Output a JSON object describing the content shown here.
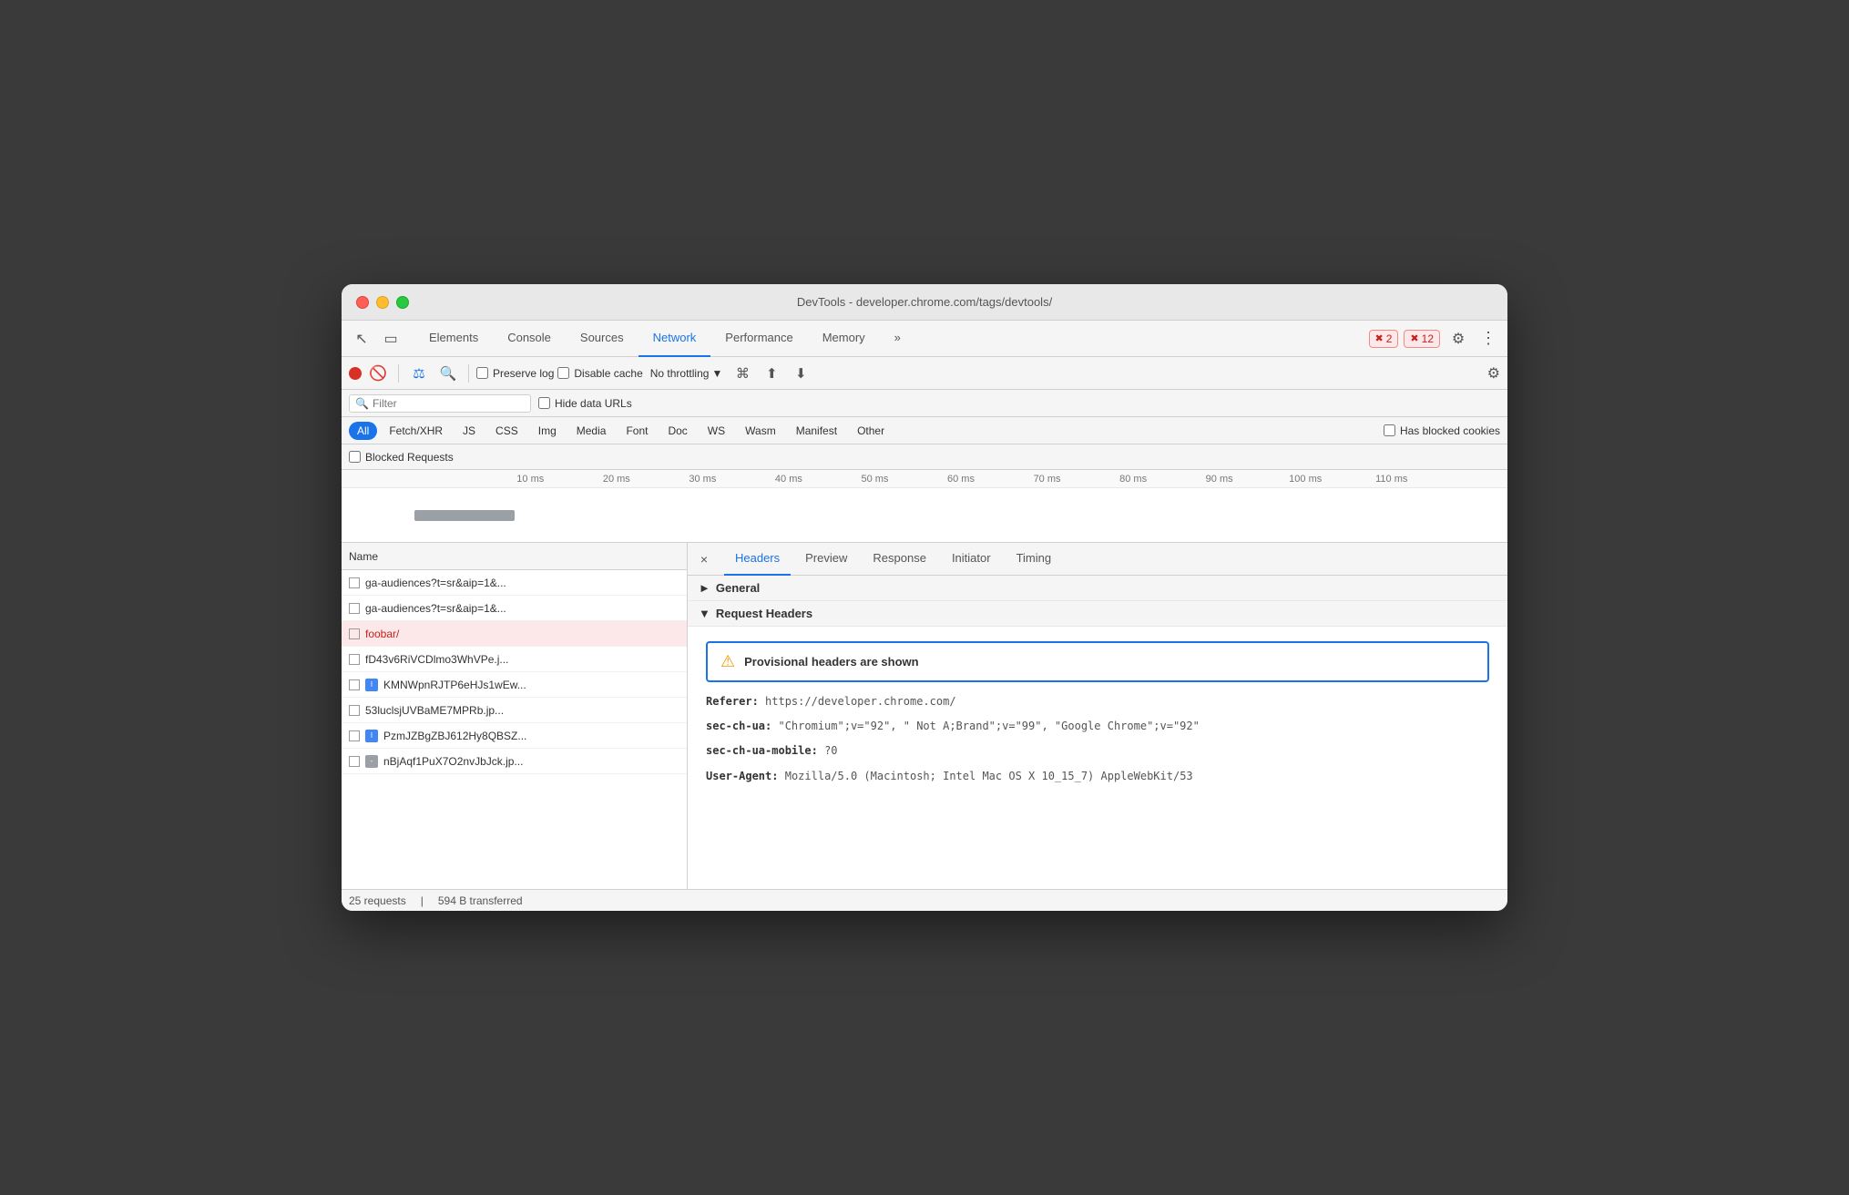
{
  "window": {
    "title": "DevTools - developer.chrome.com/tags/devtools/"
  },
  "devtools": {
    "tabs": [
      {
        "label": "Elements",
        "active": false
      },
      {
        "label": "Console",
        "active": false
      },
      {
        "label": "Sources",
        "active": false
      },
      {
        "label": "Network",
        "active": true
      },
      {
        "label": "Performance",
        "active": false
      },
      {
        "label": "Memory",
        "active": false
      }
    ],
    "more_label": "»",
    "error_count": "2",
    "warning_count": "12"
  },
  "toolbar": {
    "preserve_log_label": "Preserve log",
    "disable_cache_label": "Disable cache",
    "throttle_label": "No throttling",
    "hide_data_urls_label": "Hide data URLs",
    "filter_placeholder": "Filter"
  },
  "type_filters": [
    {
      "label": "All",
      "active": true
    },
    {
      "label": "Fetch/XHR",
      "active": false
    },
    {
      "label": "JS",
      "active": false
    },
    {
      "label": "CSS",
      "active": false
    },
    {
      "label": "Img",
      "active": false
    },
    {
      "label": "Media",
      "active": false
    },
    {
      "label": "Font",
      "active": false
    },
    {
      "label": "Doc",
      "active": false
    },
    {
      "label": "WS",
      "active": false
    },
    {
      "label": "Wasm",
      "active": false
    },
    {
      "label": "Manifest",
      "active": false
    },
    {
      "label": "Other",
      "active": false
    }
  ],
  "has_blocked_cookies_label": "Has blocked cookies",
  "blocked_requests_label": "Blocked Requests",
  "timeline": {
    "labels": [
      "10 ms",
      "20 ms",
      "30 ms",
      "40 ms",
      "50 ms",
      "60 ms",
      "70 ms",
      "80 ms",
      "90 ms",
      "100 ms",
      "110 ms"
    ]
  },
  "requests": {
    "header": "Name",
    "items": [
      {
        "name": "ga-audiences?t=sr&aip=1&...",
        "type": "default",
        "selected": false,
        "error": false
      },
      {
        "name": "ga-audiences?t=sr&aip=1&...",
        "type": "default",
        "selected": false,
        "error": false
      },
      {
        "name": "foobar/",
        "type": "default",
        "selected": true,
        "error": true
      },
      {
        "name": "fD43v6RiVCDlmo3WhVPe.j...",
        "type": "default",
        "selected": false,
        "error": false
      },
      {
        "name": "KMNWpnRJTP6eHJs1wEw...",
        "type": "image",
        "selected": false,
        "error": false
      },
      {
        "name": "53luclsjUVBaME7MPRb.jp...",
        "type": "default",
        "selected": false,
        "error": false
      },
      {
        "name": "PzmJZBgZBJ612Hy8QBSZ...",
        "type": "image",
        "selected": false,
        "error": false
      },
      {
        "name": "nBjAqf1PuX7O2nvJbJck.jp...",
        "type": "partial",
        "selected": false,
        "error": false
      }
    ]
  },
  "status_bar": {
    "requests_label": "25 requests",
    "transferred_label": "594 B transferred"
  },
  "details": {
    "close_icon": "×",
    "tabs": [
      {
        "label": "Headers",
        "active": true
      },
      {
        "label": "Preview",
        "active": false
      },
      {
        "label": "Response",
        "active": false
      },
      {
        "label": "Initiator",
        "active": false
      },
      {
        "label": "Timing",
        "active": false
      }
    ],
    "general_section": "General",
    "request_headers_section": "Request Headers",
    "provisional_warning": "Provisional headers are shown",
    "warning_icon": "⚠",
    "headers": [
      {
        "name": "Referer:",
        "value": "https://developer.chrome.com/"
      },
      {
        "name": "sec-ch-ua:",
        "value": "\"Chromium\";v=\"92\", \" Not A;Brand\";v=\"99\", \"Google Chrome\";v=\"92\""
      },
      {
        "name": "sec-ch-ua-mobile:",
        "value": "?0"
      },
      {
        "name": "User-Agent:",
        "value": "Mozilla/5.0 (Macintosh; Intel Mac OS X 10_15_7) AppleWebKit/53"
      }
    ]
  }
}
